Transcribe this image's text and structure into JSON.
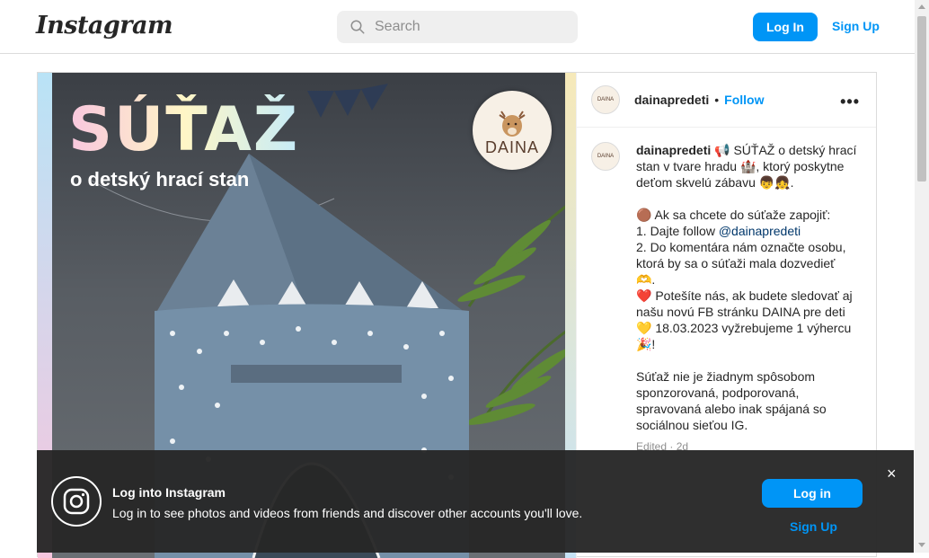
{
  "header": {
    "logo": "Instagram",
    "search_placeholder": "Search",
    "login_label": "Log In",
    "signup_label": "Sign Up"
  },
  "post": {
    "image": {
      "title": "SÚŤAŽ",
      "subtitle": "o detský hrací stan",
      "brand": "DAINA"
    },
    "header": {
      "username": "dainapredeti",
      "dot": "•",
      "follow_label": "Follow",
      "more": "•••"
    },
    "caption": {
      "username": "dainapredeti",
      "line1": " 📢 SÚŤAŽ o detský hrací stan v tvare hradu 🏰, ktorý poskytne deťom skvelú zábavu 👦👧.",
      "line2": "🟤 Ak sa chcete do súťaže zapojiť:",
      "line3a": "1. Dajte follow ",
      "mention": "@dainapredeti",
      "line4": "2. Do komentára nám označte osobu, ktorá by sa o súťaži mala dozvedieť 🫶.",
      "line5": "❤️ Potešíte nás, ak budete sledovať aj našu novú FB stránku DAINA pre deti",
      "line6": "💛 18.03.2023 vyžrebujeme 1 výhercu 🎉!",
      "line7": "Súťaž nie je žiadnym spôsobom sponzorovaná, podporovaná, spravovaná alebo inak spájaná so sociálnou sieťou IG.",
      "edited": "Edited · 2d"
    },
    "avatar_text": "DAINA"
  },
  "banner": {
    "title": "Log into Instagram",
    "text": "Log in to see photos and videos from friends and discover other accounts you'll love.",
    "login_label": "Log in",
    "signup_label": "Sign Up",
    "close": "×"
  },
  "colors": {
    "accent": "#0095f6",
    "banner_bg": "#262626"
  }
}
